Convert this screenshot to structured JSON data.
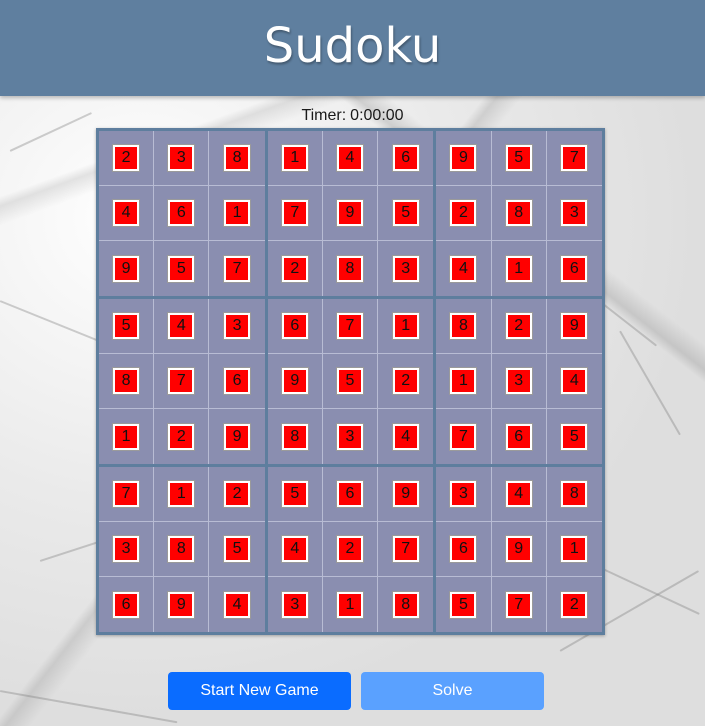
{
  "app": {
    "title": "Sudoku"
  },
  "timer": {
    "label": "Timer:",
    "value": "0:00:00"
  },
  "board": {
    "rows": [
      [
        "2",
        "3",
        "8",
        "1",
        "4",
        "6",
        "9",
        "5",
        "7"
      ],
      [
        "4",
        "6",
        "1",
        "7",
        "9",
        "5",
        "2",
        "8",
        "3"
      ],
      [
        "9",
        "5",
        "7",
        "2",
        "8",
        "3",
        "4",
        "1",
        "6"
      ],
      [
        "5",
        "4",
        "3",
        "6",
        "7",
        "1",
        "8",
        "2",
        "9"
      ],
      [
        "8",
        "7",
        "6",
        "9",
        "5",
        "2",
        "1",
        "3",
        "4"
      ],
      [
        "1",
        "2",
        "9",
        "8",
        "3",
        "4",
        "7",
        "6",
        "5"
      ],
      [
        "7",
        "1",
        "2",
        "5",
        "6",
        "9",
        "3",
        "4",
        "8"
      ],
      [
        "3",
        "8",
        "5",
        "4",
        "2",
        "7",
        "6",
        "9",
        "1"
      ],
      [
        "6",
        "9",
        "4",
        "3",
        "1",
        "8",
        "5",
        "7",
        "2"
      ]
    ]
  },
  "buttons": {
    "new_game": "Start New Game",
    "solve": "Solve"
  },
  "colors": {
    "header": "#5f7f9f",
    "board_frame": "#5e7e9e",
    "board_fill": "#8a8eb0",
    "tile": "#ff0000",
    "primary_button": "#0a6cff",
    "secondary_button": "#5aa1ff"
  }
}
